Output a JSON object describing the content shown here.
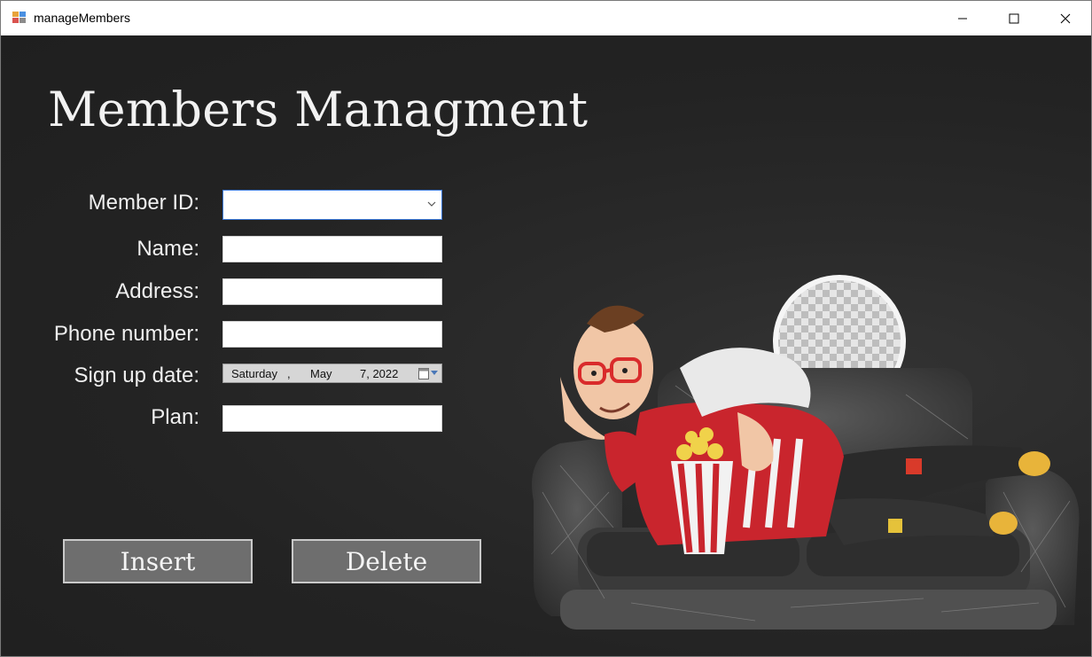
{
  "window": {
    "title": "manageMembers"
  },
  "heading": "Members Managment",
  "form": {
    "member_id_label": "Member ID:",
    "member_id_value": "",
    "name_label": "Name:",
    "name_value": "",
    "address_label": "Address:",
    "address_value": "",
    "phone_label": "Phone number:",
    "phone_value": "",
    "signup_label": "Sign up date:",
    "signup_date": {
      "weekday": "Saturday",
      "sep": ",",
      "month": "May",
      "day_year": "7, 2022"
    },
    "plan_label": "Plan:",
    "plan_value": ""
  },
  "buttons": {
    "insert": "Insert",
    "delete": "Delete"
  },
  "colors": {
    "background": "#232323",
    "button_bg": "#6e6e6e",
    "text": "#f0f0f0",
    "combo_focus": "#3b78d8"
  }
}
